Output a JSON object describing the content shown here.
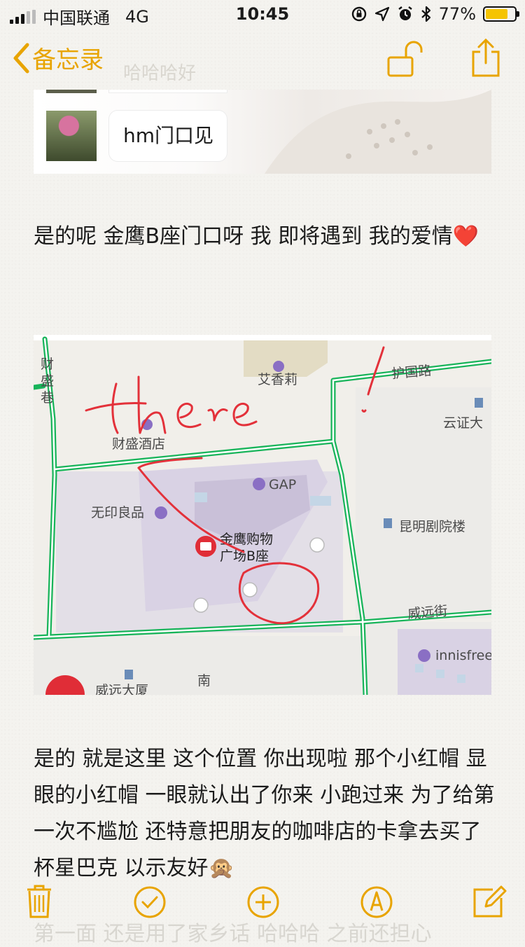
{
  "status": {
    "carrier": "中国联通",
    "network": "4G",
    "time": "10:45",
    "battery": "77%",
    "battery_level": 0.77
  },
  "nav": {
    "back_label": "备忘录",
    "ghost_text": "哈哈哈好"
  },
  "chat": {
    "bubble_text": "hm门口见"
  },
  "note": {
    "paragraph1": "是的呢 金鹰B座门口呀 我 即将遇到 我的爱情",
    "heart": "❤️",
    "paragraph2": "是的 就是这里 这个位置 你出现啦 那个小红帽 显眼的小红帽 一眼就认出了你来 小跑过来 为了给第一次不尴尬 还特意把朋友的咖啡店的卡拿去买了杯星巴克 以示友好🙊",
    "ghost_bottom": "第一面 还是用了家乡话 哈哈哈 之前还担心"
  },
  "map": {
    "labels": {
      "caisheng_lane": "财盛巷",
      "aixiangli": "艾香莉",
      "huguo_road": "护国路",
      "yunzheng": "云证大",
      "caisheng_hotel": "财盛酒店",
      "gap": "GAP",
      "muji": "无印良品",
      "theatre": "昆明剧院楼",
      "mall_line1": "金鹰购物",
      "mall_line2": "广场B座",
      "weiyuan_street": "威远街",
      "innisfree": "innisfree",
      "weiyuan_building": "威远大厦",
      "nan": "南"
    },
    "handwriting": "there!"
  },
  "colors": {
    "accent": "#e8a400",
    "road_green": "#18b45a",
    "mall_fill": "#d9d2e4",
    "ink_red": "#e3313a",
    "poi_purple": "#8a6fc4"
  },
  "toolbar": {
    "icons": [
      "trash-icon",
      "checklist-icon",
      "add-icon",
      "sketch-icon",
      "compose-icon"
    ]
  }
}
